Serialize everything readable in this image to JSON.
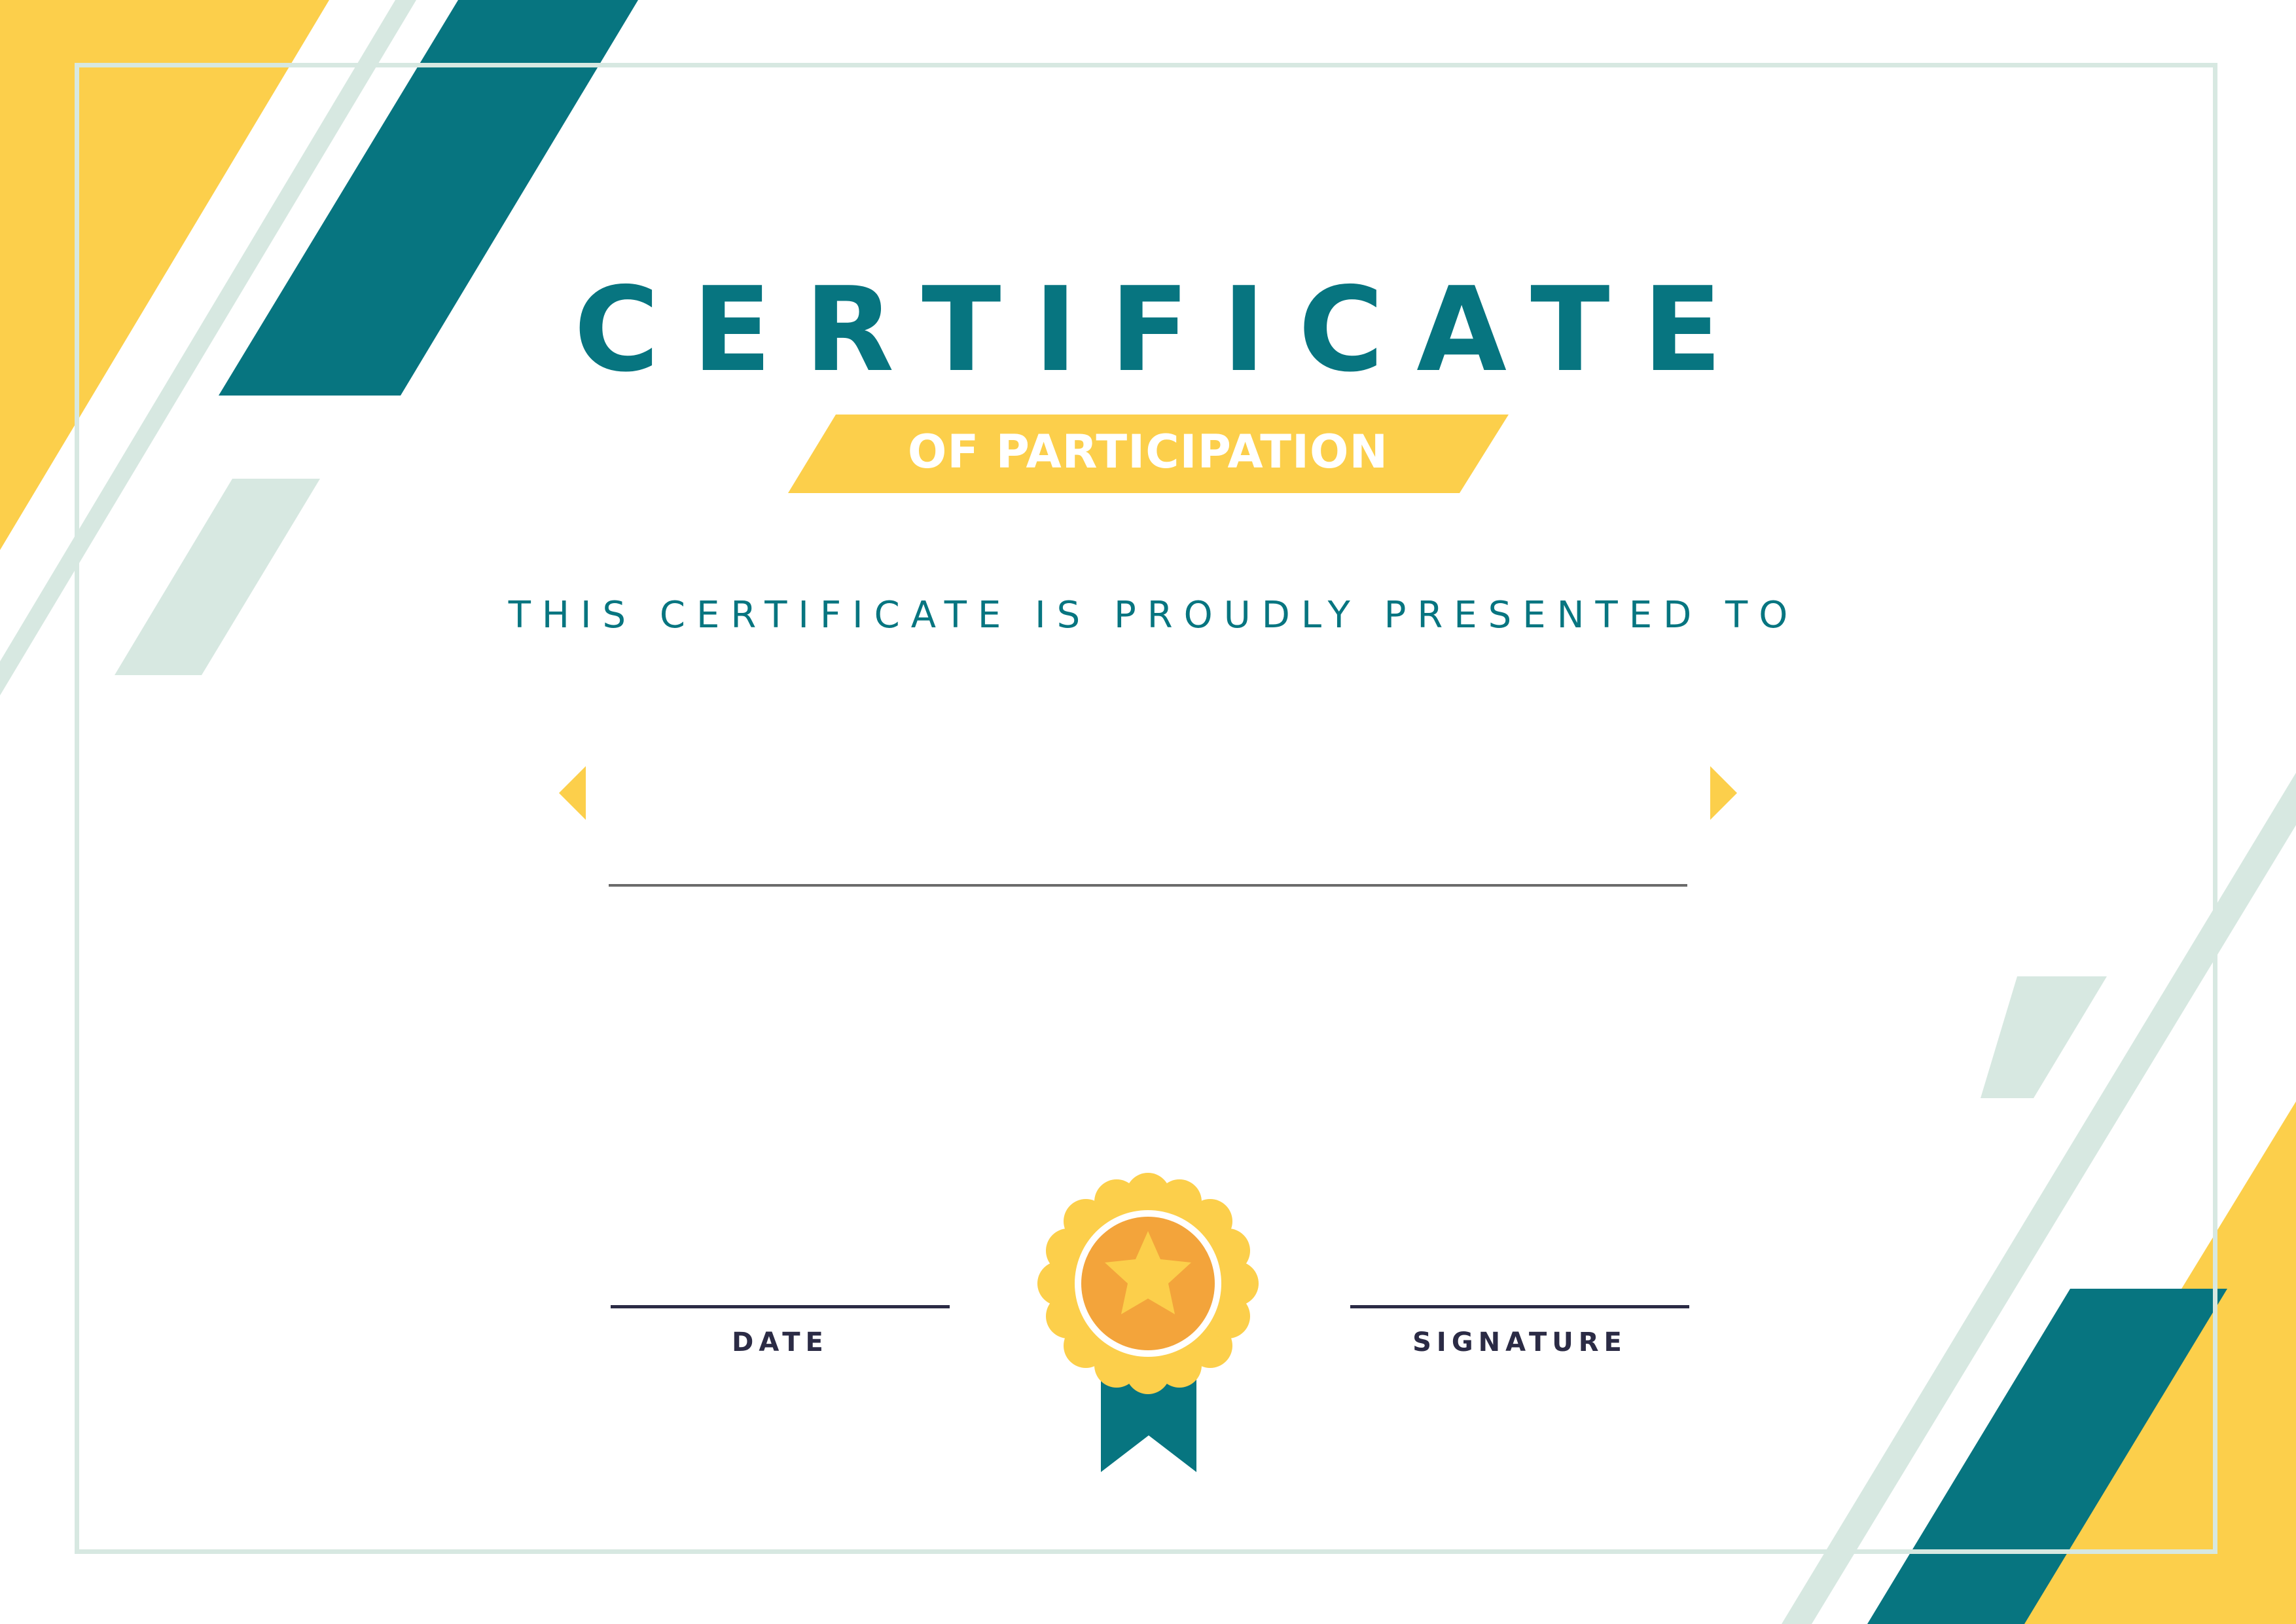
{
  "certificate": {
    "title": "CERTIFICATE",
    "subtitle": "OF PARTICIPATION",
    "presented_to": "THIS CERTIFICATE IS PROUDLY PRESENTED TO",
    "recipient_name": "",
    "date_label": "DATE",
    "signature_label": "SIGNATURE"
  },
  "colors": {
    "teal": "#077580",
    "yellow": "#fccf4b",
    "pale_green": "#d7e8e1",
    "orange": "#f3a43b",
    "navy": "#2b2b45",
    "white": "#ffffff"
  },
  "icons": {
    "medal": "award-medal-icon",
    "star": "star-icon",
    "left_marker": "triangle-left-icon",
    "right_marker": "triangle-right-icon"
  }
}
